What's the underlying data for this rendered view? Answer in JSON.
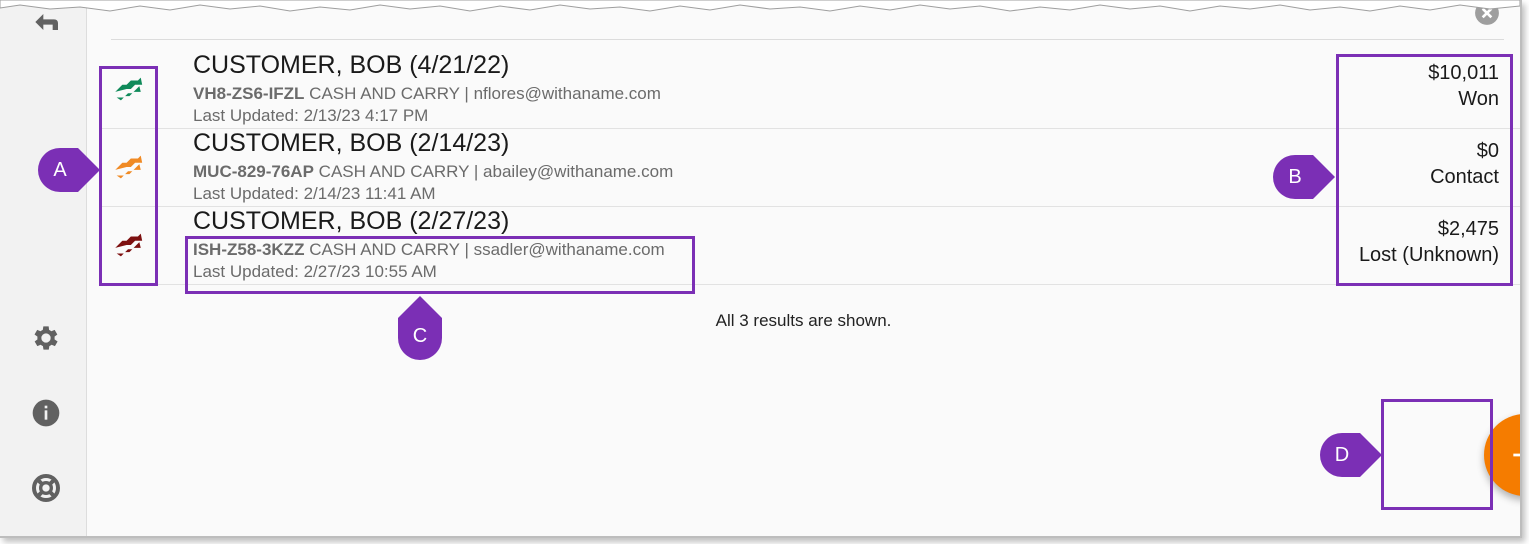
{
  "colors": {
    "won": "#0f8a5a",
    "contact": "#f08a24",
    "lost": "#7d1010",
    "accent": "#f57c00",
    "annotation": "#7b2fb5"
  },
  "sidebar": {
    "icons": [
      "exit-icon",
      "gear-icon",
      "info-icon",
      "help-icon"
    ]
  },
  "opportunities": [
    {
      "title": "CUSTOMER, BOB (4/21/22)",
      "code": "VH8-ZS6-IFZL",
      "details": " CASH AND CARRY | nflores@withaname.com",
      "updated": "Last Updated: 2/13/23 4:17 PM",
      "amount": "$10,011",
      "stage": "Won",
      "status": "won"
    },
    {
      "title": "CUSTOMER, BOB (2/14/23)",
      "code": "MUC-829-76AP",
      "details": " CASH AND CARRY | abailey@withaname.com",
      "updated": "Last Updated: 2/14/23 11:41 AM",
      "amount": "$0",
      "stage": "Contact",
      "status": "contact"
    },
    {
      "title": "CUSTOMER, BOB (2/27/23)",
      "code": "ISH-Z58-3KZZ",
      "details": " CASH AND CARRY | ssadler@withaname.com",
      "updated": "Last Updated: 2/27/23 10:55 AM",
      "amount": "$2,475",
      "stage": "Lost (Unknown)",
      "status": "lost"
    }
  ],
  "results_text": "All 3 results are shown.",
  "fab": {
    "icon": "plus-icon"
  },
  "callouts": {
    "a": "A",
    "b": "B",
    "c": "C",
    "d": "D"
  }
}
